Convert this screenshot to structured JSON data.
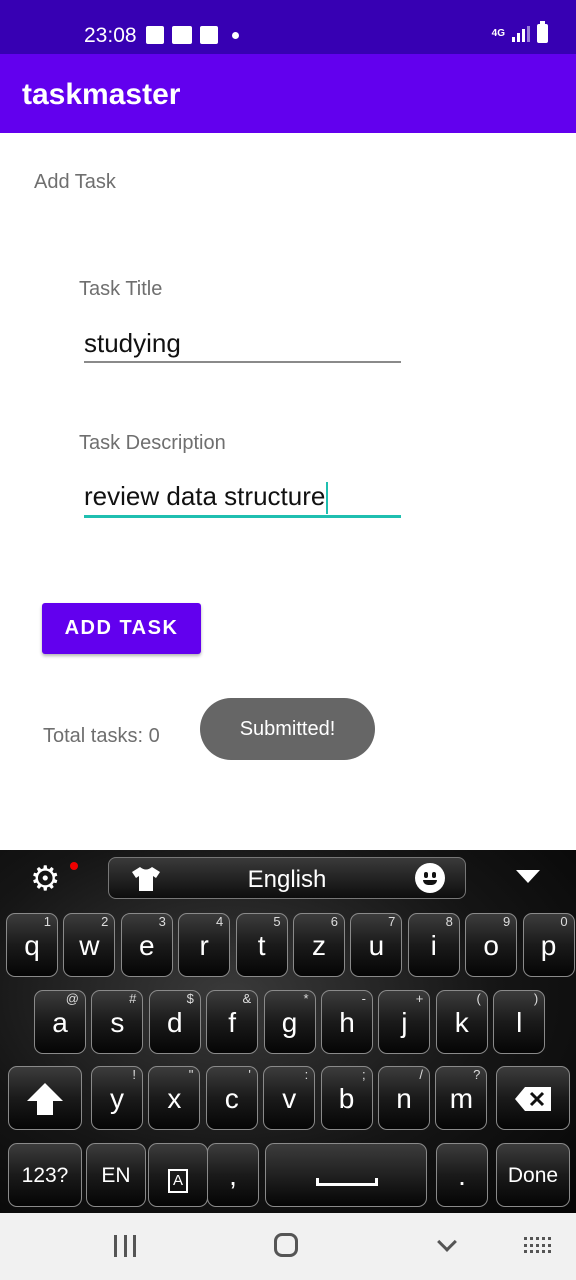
{
  "status_bar": {
    "time": "23:08",
    "network": "4G"
  },
  "app_bar": {
    "title": "taskmaster"
  },
  "form": {
    "section_label": "Add Task",
    "title_label": "Task Title",
    "title_value": "studying",
    "description_label": "Task Description",
    "description_value": "review data structure",
    "submit_label": "ADD TASK"
  },
  "total_tasks": "Total tasks: 0",
  "toast": "Submitted!",
  "keyboard": {
    "language": "English",
    "row1": [
      {
        "key": "q",
        "hint": "1"
      },
      {
        "key": "w",
        "hint": "2"
      },
      {
        "key": "e",
        "hint": "3"
      },
      {
        "key": "r",
        "hint": "4"
      },
      {
        "key": "t",
        "hint": "5"
      },
      {
        "key": "z",
        "hint": "6"
      },
      {
        "key": "u",
        "hint": "7"
      },
      {
        "key": "i",
        "hint": "8"
      },
      {
        "key": "o",
        "hint": "9"
      },
      {
        "key": "p",
        "hint": "0"
      }
    ],
    "row2": [
      {
        "key": "a",
        "hint": "@"
      },
      {
        "key": "s",
        "hint": "#"
      },
      {
        "key": "d",
        "hint": "$"
      },
      {
        "key": "f",
        "hint": "&"
      },
      {
        "key": "g",
        "hint": "*"
      },
      {
        "key": "h",
        "hint": "-"
      },
      {
        "key": "j",
        "hint": "+"
      },
      {
        "key": "k",
        "hint": "("
      },
      {
        "key": "l",
        "hint": ")"
      }
    ],
    "row3": [
      {
        "key": "y",
        "hint": "!"
      },
      {
        "key": "x",
        "hint": "\""
      },
      {
        "key": "c",
        "hint": "'"
      },
      {
        "key": "v",
        "hint": ":"
      },
      {
        "key": "b",
        "hint": ";"
      },
      {
        "key": "n",
        "hint": "/"
      },
      {
        "key": "m",
        "hint": "?"
      }
    ],
    "symbols_label": "123?",
    "lang_key_label": "EN",
    "comma_label": ",",
    "period_label": ".",
    "done_label": "Done"
  },
  "colors": {
    "primary": "#6200ee",
    "primary_dark": "#3700b3",
    "accent": "#1fbfb0",
    "toast_bg": "#666666"
  }
}
